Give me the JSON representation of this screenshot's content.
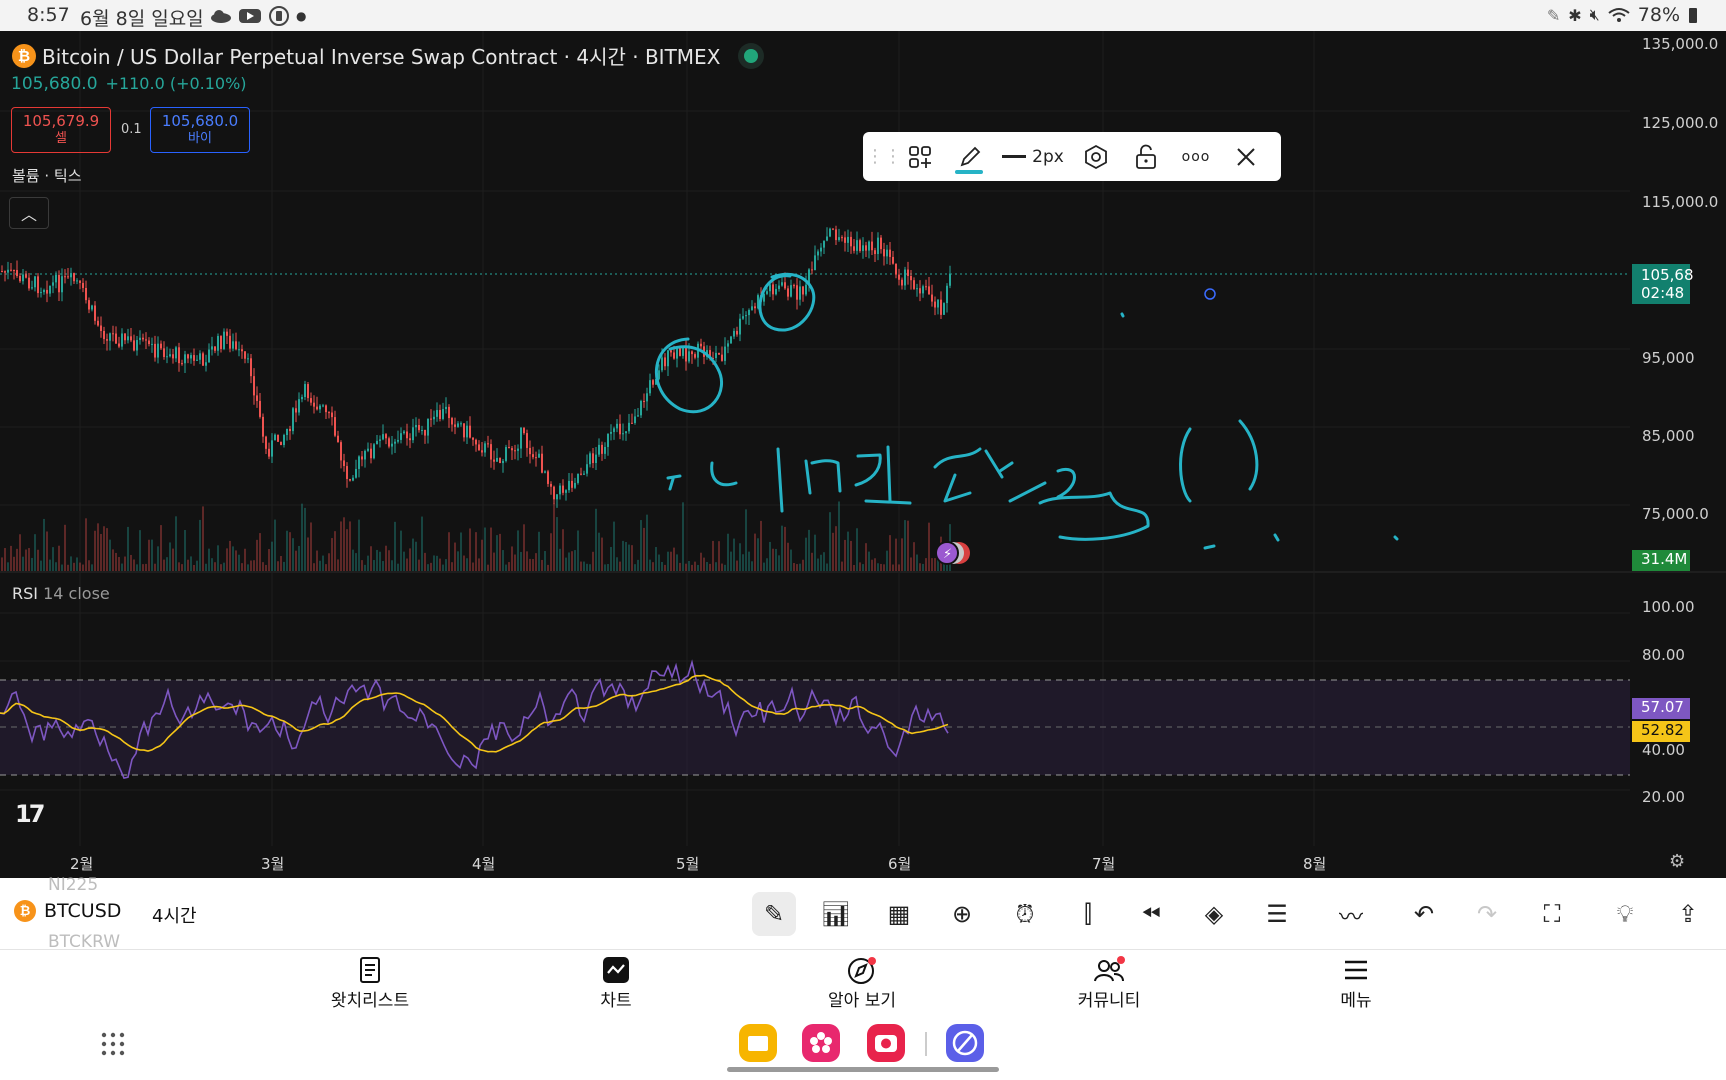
{
  "status_bar": {
    "time": "8:57",
    "date": "6월 8일 일요일",
    "battery": "78%"
  },
  "chart_header": {
    "title": "Bitcoin / US Dollar Perpetual Inverse Swap Contract · 4시간 · BITMEX",
    "last_price": "105,680.0",
    "change": "+110.0 (+0.10%)",
    "sell_price": "105,679.9",
    "sell_label": "셀",
    "spread": "0.1",
    "buy_price": "105,680.0",
    "buy_label": "바이",
    "volume_label": "볼륨 · 틱스",
    "rsi_label": "RSI",
    "rsi_params": "14 close",
    "logo": "17"
  },
  "y_axis": {
    "labels": [
      "135,000.0",
      "125,000.0",
      "115,000.0",
      "95,000",
      "85,000",
      "75,000.0"
    ],
    "current_price_tag": "105,68",
    "countdown_tag": "02:48",
    "volume_tag": "31.4M",
    "rsi_labels": [
      "100.00",
      "80.00",
      "40.00",
      "20.00"
    ],
    "rsi_value_tag": "57.07",
    "rsi_ma_tag": "52.82"
  },
  "x_axis": {
    "labels": [
      "2월",
      "3월",
      "4월",
      "5월",
      "6월",
      "7월",
      "8월"
    ]
  },
  "handwriting": {
    "text": "다시 비트코인 상승할까?"
  },
  "drawing_toolbar": {
    "width_label": "2px",
    "pen_color": "#26b3c6"
  },
  "bottom_toolbar": {
    "symbol": "BTCUSD",
    "interval": "4시간",
    "ghost_above": "NI225",
    "ghost_below": "BTCKRW",
    "tools": [
      "pen-icon",
      "indicators-icon",
      "templates-icon",
      "add-icon",
      "alert-icon",
      "bar-style-icon",
      "replay-icon",
      "layers-icon",
      "settings-icon",
      "trend-icon",
      "undo-icon",
      "redo-icon",
      "fullscreen-icon",
      "idea-icon",
      "share-icon"
    ]
  },
  "bottom_nav": {
    "items": [
      {
        "label": "왓치리스트",
        "icon": "watchlist-icon"
      },
      {
        "label": "차트",
        "icon": "chart-icon"
      },
      {
        "label": "알아 보기",
        "icon": "explore-icon"
      },
      {
        "label": "커뮤니티",
        "icon": "community-icon"
      },
      {
        "label": "메뉴",
        "icon": "menu-icon"
      }
    ]
  },
  "colors": {
    "up": "#26a69a",
    "down": "#ef5350",
    "rsi": "#7e57c2",
    "rsi_ma": "#f5c518",
    "pen": "#26b3c6",
    "chart_bg": "#121212"
  }
}
